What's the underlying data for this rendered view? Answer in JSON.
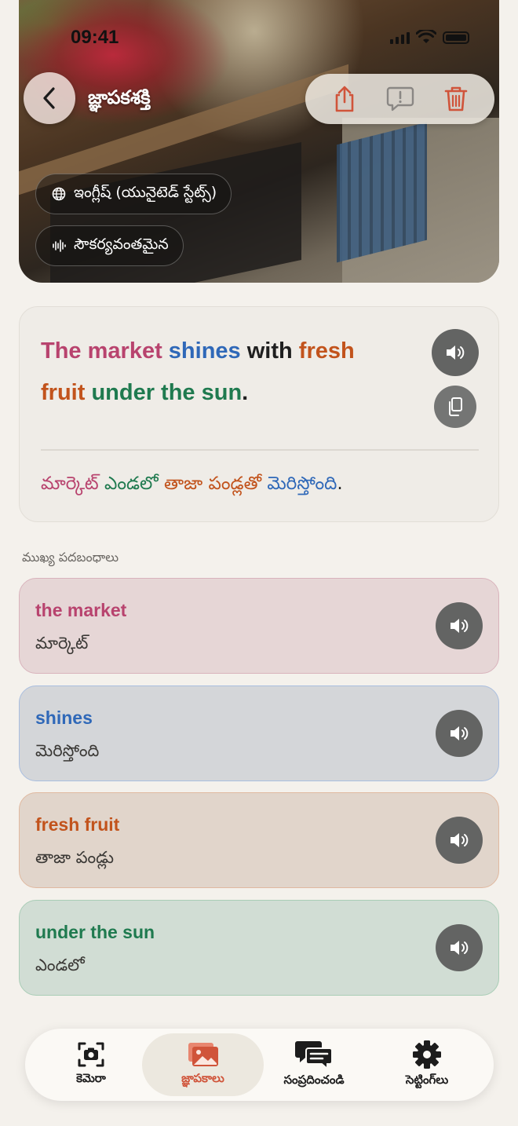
{
  "status_bar": {
    "time": "09:41"
  },
  "header": {
    "title": "జ్ఞాపకశక్తి",
    "language_chip": "ఇంగ్లీష్ (యునైటెడ్ స్టేట్స్)",
    "voice_chip": "సౌకర్యవంతమైన"
  },
  "sentence": {
    "en_parts": [
      {
        "text": "The market",
        "color": "#b8436e"
      },
      {
        "text": " ",
        "color": "#1f1f1f"
      },
      {
        "text": "shines",
        "color": "#2f68b8"
      },
      {
        "text": " with ",
        "color": "#1f1f1f"
      },
      {
        "text": "fresh fruit",
        "color": "#c2531c"
      },
      {
        "text": " ",
        "color": "#1f1f1f"
      },
      {
        "text": "under the sun",
        "color": "#1f7a4f"
      },
      {
        "text": ".",
        "color": "#1f1f1f"
      }
    ],
    "te_parts": [
      {
        "text": "మార్కెట్",
        "color": "#b8436e"
      },
      {
        "text": " ",
        "color": "#222"
      },
      {
        "text": "ఎండలో",
        "color": "#1f7a4f"
      },
      {
        "text": " ",
        "color": "#222"
      },
      {
        "text": "తాజా పండ్లతో",
        "color": "#c2531c"
      },
      {
        "text": " ",
        "color": "#222"
      },
      {
        "text": "మెరిస్తోంది",
        "color": "#2f68b8"
      },
      {
        "text": ".",
        "color": "#222"
      }
    ]
  },
  "section_label": "ముఖ్య పదబంధాలు",
  "phrases": [
    {
      "en": "the market",
      "te": "మార్కెట్",
      "color": "#b8436e"
    },
    {
      "en": "shines",
      "te": "మెరిస్తోంది",
      "color": "#2f68b8"
    },
    {
      "en": "fresh fruit",
      "te": "తాజా పండ్లు",
      "color": "#c2531c"
    },
    {
      "en": "under the sun",
      "te": "ఎండలో",
      "color": "#1f7a4f"
    }
  ],
  "tabs": [
    {
      "label": "కెమెరా",
      "icon": "camera-icon",
      "active": false
    },
    {
      "label": "జ్ఞాపకాలు",
      "icon": "photos-icon",
      "active": true
    },
    {
      "label": "సంప్రదించండి",
      "icon": "chat-icon",
      "active": false
    },
    {
      "label": "సెట్టింగ్‌లు",
      "icon": "gear-icon",
      "active": false
    }
  ],
  "colors": {
    "accent": "#d0543a",
    "button": "#636463",
    "background": "#f4f1ec"
  }
}
